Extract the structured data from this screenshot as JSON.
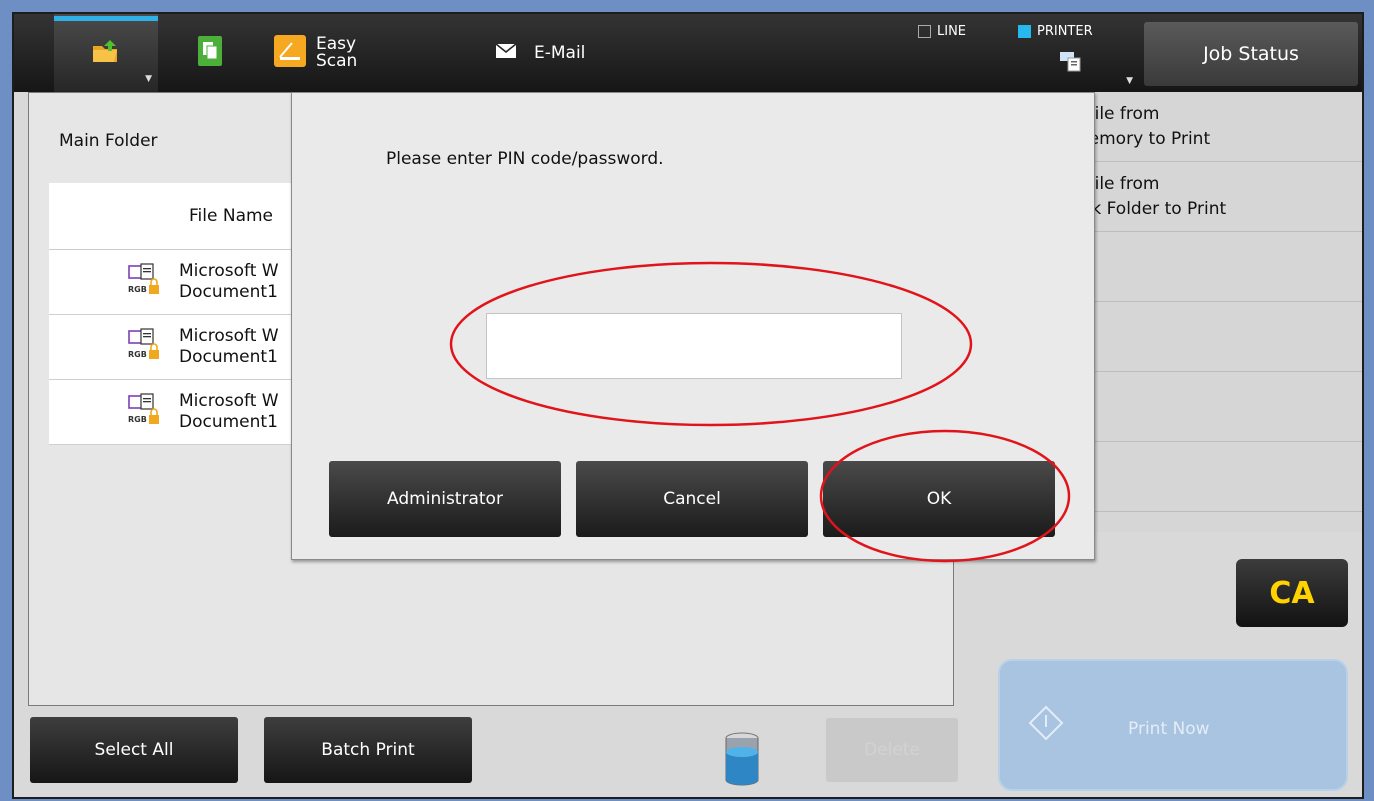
{
  "topbar": {
    "tabs": {
      "folder": {
        "icon": "folder-icon"
      },
      "copy": {
        "icon": "copy-icon"
      },
      "easy_scan": {
        "label_line1": "Easy",
        "label_line2": "Scan",
        "icon": "easy-scan-icon"
      },
      "email": {
        "label": "E-Mail",
        "icon": "envelope-icon"
      }
    },
    "indicators": {
      "line": "LINE",
      "printer": "PRINTER"
    },
    "job_status": "Job Status"
  },
  "left_panel": {
    "folder_label": "Main Folder",
    "table": {
      "header": "File Name",
      "rows": [
        {
          "line1": "Microsoft W",
          "line2": "Document1"
        },
        {
          "line1": "Microsoft W",
          "line2": "Document1"
        },
        {
          "line1": "Microsoft W",
          "line2": "Document1"
        }
      ]
    }
  },
  "right_panel": {
    "items": [
      {
        "line1": "t File from",
        "line2": "Memory to Print"
      },
      {
        "line1": "t File from",
        "line2": "ork Folder to Print"
      }
    ],
    "ca_label": "CA",
    "print_now": "Print Now"
  },
  "bottom": {
    "select_all": "Select All",
    "batch_print": "Batch Print",
    "delete": "Delete"
  },
  "dialog": {
    "message": "Please enter PIN code/password.",
    "pin_value": "",
    "buttons": {
      "administrator": "Administrator",
      "cancel": "Cancel",
      "ok": "OK"
    }
  },
  "colors": {
    "accent_blue": "#27b8f0",
    "ca_yellow": "#ffd200",
    "annotation_red": "#e0141a"
  }
}
